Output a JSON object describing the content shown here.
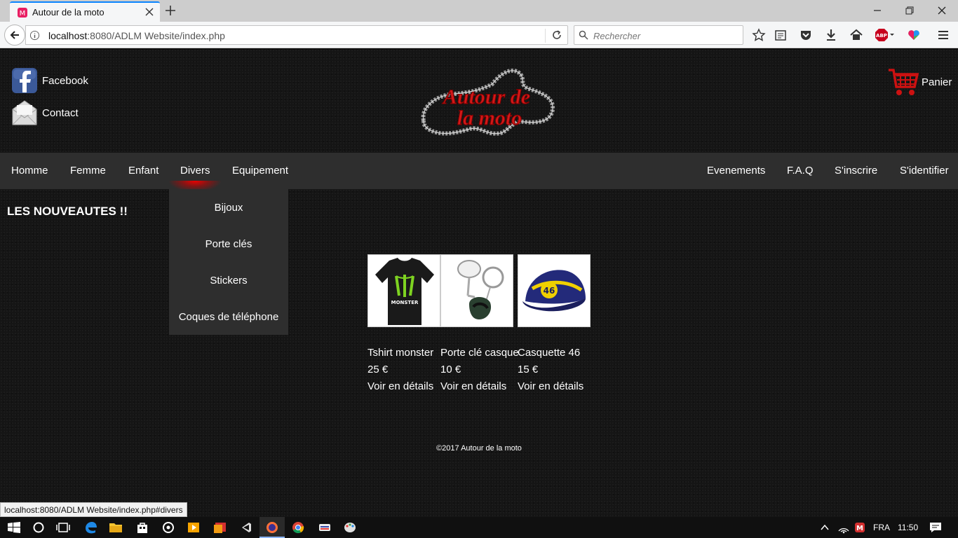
{
  "browser": {
    "tab_title": "Autour de la moto",
    "url_prefix": "localhost",
    "url_rest": ":8080/ADLM Website/index.php",
    "search_placeholder": "Rechercher",
    "status_url": "localhost:8080/ADLM Website/index.php#divers"
  },
  "header": {
    "facebook_label": "Facebook",
    "contact_label": "Contact",
    "logo_line1": "Autour de",
    "logo_line2": "la moto",
    "cart_label": "Panier"
  },
  "menu": {
    "left": [
      "Homme",
      "Femme",
      "Enfant",
      "Divers",
      "Equipement"
    ],
    "right": [
      "Evenements",
      "F.A.Q",
      "S'inscrire",
      "S'identifier"
    ],
    "dropdown": [
      "Bijoux",
      "Porte clés",
      "Stickers",
      "Coques de téléphone"
    ]
  },
  "main": {
    "title": "LES NOUVEAUTES !!",
    "products": [
      {
        "name": "Tshirt monster",
        "price": "25 €",
        "link": "Voir en détails",
        "image_text": "MONSTER"
      },
      {
        "name": "Porte clé casque",
        "price": "10 €",
        "link": "Voir en détails"
      },
      {
        "name": "Casquette 46",
        "price": "15 €",
        "link": "Voir en détails",
        "image_text": "46"
      }
    ]
  },
  "footer": {
    "text": "©2017 Autour de la moto"
  },
  "taskbar": {
    "lang": "FRA",
    "time": "11:50"
  },
  "colors": {
    "accent_red": "#cc1111",
    "menu_bg": "#2e2e2e",
    "page_bg": "#151515"
  }
}
